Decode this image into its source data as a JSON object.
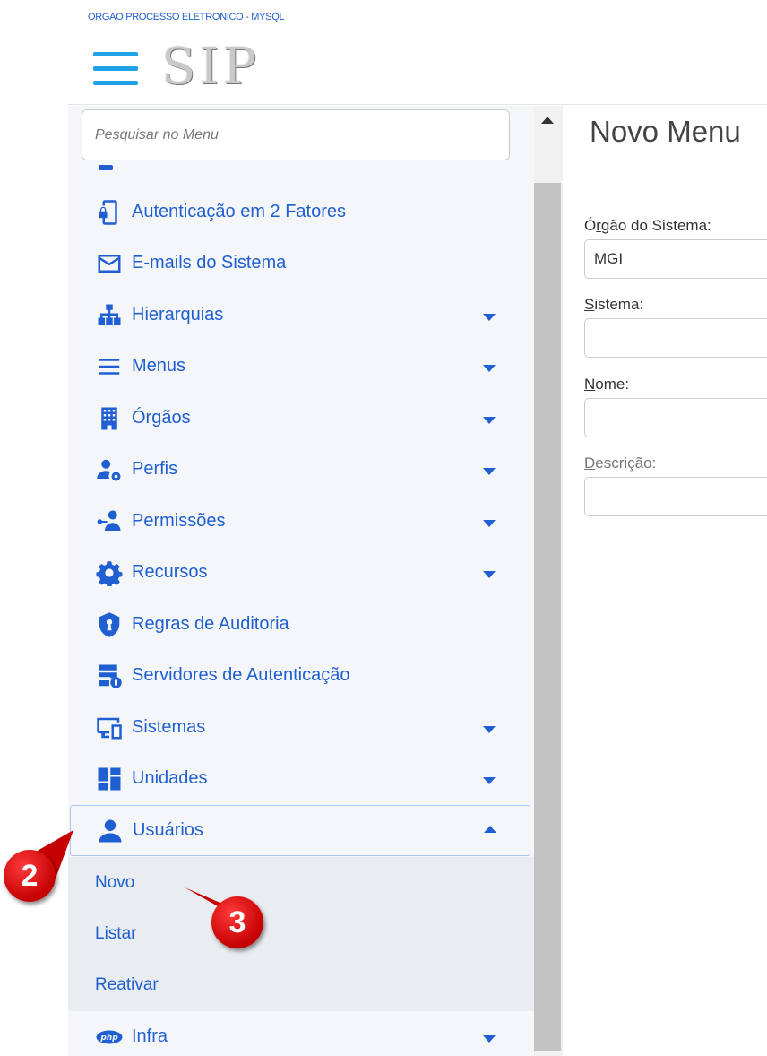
{
  "header": {
    "org_title": "ORGAO PROCESSO ELETRONICO - MYSQL",
    "logo": "SIP"
  },
  "sidebar": {
    "search_placeholder": "Pesquisar no Menu",
    "items": [
      {
        "label": "Autenticação em 2 Fatores",
        "icon": "mobile-lock-icon",
        "expandable": false
      },
      {
        "label": "E-mails do Sistema",
        "icon": "envelope-icon",
        "expandable": true
      },
      {
        "label": "Hierarquias",
        "icon": "sitemap-icon",
        "expandable": true
      },
      {
        "label": "Menus",
        "icon": "bars-icon",
        "expandable": true
      },
      {
        "label": "Órgãos",
        "icon": "building-icon",
        "expandable": true
      },
      {
        "label": "Perfis",
        "icon": "user-gear-icon",
        "expandable": true
      },
      {
        "label": "Permissões",
        "icon": "user-key-icon",
        "expandable": true
      },
      {
        "label": "Recursos",
        "icon": "gear-icon",
        "expandable": true
      },
      {
        "label": "Regras de Auditoria",
        "icon": "shield-keyhole-icon",
        "expandable": false
      },
      {
        "label": "Servidores de Autenticação",
        "icon": "server-lock-icon",
        "expandable": false
      },
      {
        "label": "Sistemas",
        "icon": "desktop-icon",
        "expandable": true
      },
      {
        "label": "Unidades",
        "icon": "dashboard-icon",
        "expandable": true
      },
      {
        "label": "Usuários",
        "icon": "user-icon",
        "expandable": true,
        "expanded": true
      },
      {
        "label": "Infra",
        "icon": "php-icon",
        "expandable": true
      }
    ],
    "usuarios_submenu": [
      "Novo",
      "Listar",
      "Reativar"
    ]
  },
  "main": {
    "title": "Novo Menu",
    "orgao_label_pre": "Ó",
    "orgao_label_ul": "r",
    "orgao_label_post": "gão do Sistema:",
    "orgao_value": "MGI",
    "sistema_label_ul": "S",
    "sistema_label_post": "istema:",
    "sistema_value": "",
    "nome_label_ul": "N",
    "nome_label_post": "ome:",
    "nome_value": "",
    "descricao_label_ul": "D",
    "descricao_label_post": "escrição:",
    "descricao_value": ""
  },
  "callouts": {
    "step2": "2",
    "step3": "3"
  },
  "colors": {
    "accent": "#1f5fd1",
    "hamburger": "#1ea3e8",
    "callout": "#d40000"
  }
}
